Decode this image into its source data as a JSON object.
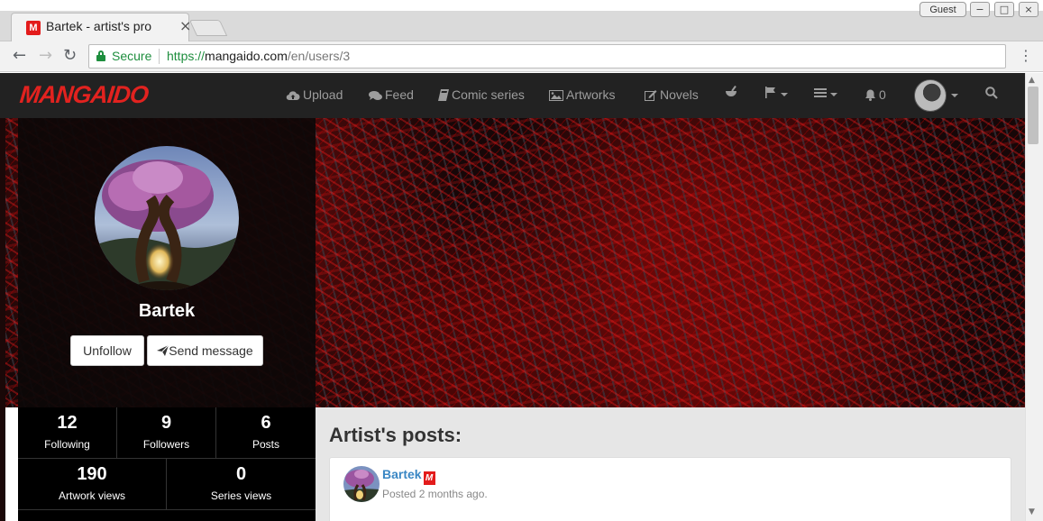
{
  "browser": {
    "tab_title": "Bartek - artist's pro",
    "tab_favicon": "M",
    "guest_label": "Guest",
    "secure_label": "Secure",
    "url_scheme": "https://",
    "url_host": "mangaido.com",
    "url_path": "/en/users/3"
  },
  "navbar": {
    "logo": "MANGAIDO",
    "items": [
      {
        "label": "Upload",
        "icon": "cloud-upload-icon"
      },
      {
        "label": "Feed",
        "icon": "comments-icon"
      },
      {
        "label": "Comic series",
        "icon": "book-icon"
      },
      {
        "label": "Artworks",
        "icon": "picture-icon"
      },
      {
        "label": "Novels",
        "icon": "edit-icon"
      }
    ],
    "notifications_count": "0"
  },
  "profile": {
    "name": "Bartek",
    "unfollow_label": "Unfollow",
    "send_message_label": "Send message"
  },
  "stats": {
    "following": {
      "value": "12",
      "label": "Following"
    },
    "followers": {
      "value": "9",
      "label": "Followers"
    },
    "posts": {
      "value": "6",
      "label": "Posts"
    },
    "artwork_views": {
      "value": "190",
      "label": "Artwork views"
    },
    "series_views": {
      "value": "0",
      "label": "Series views"
    }
  },
  "posts_section": {
    "heading": "Artist's posts:",
    "first_post": {
      "author": "Bartek",
      "badge": "M",
      "meta": "Posted 2 months ago."
    }
  },
  "colors": {
    "brand_red": "#e2221f",
    "navbar_bg": "#222222",
    "link_blue": "#3a87c4",
    "secure_green": "#1e8e3e"
  }
}
